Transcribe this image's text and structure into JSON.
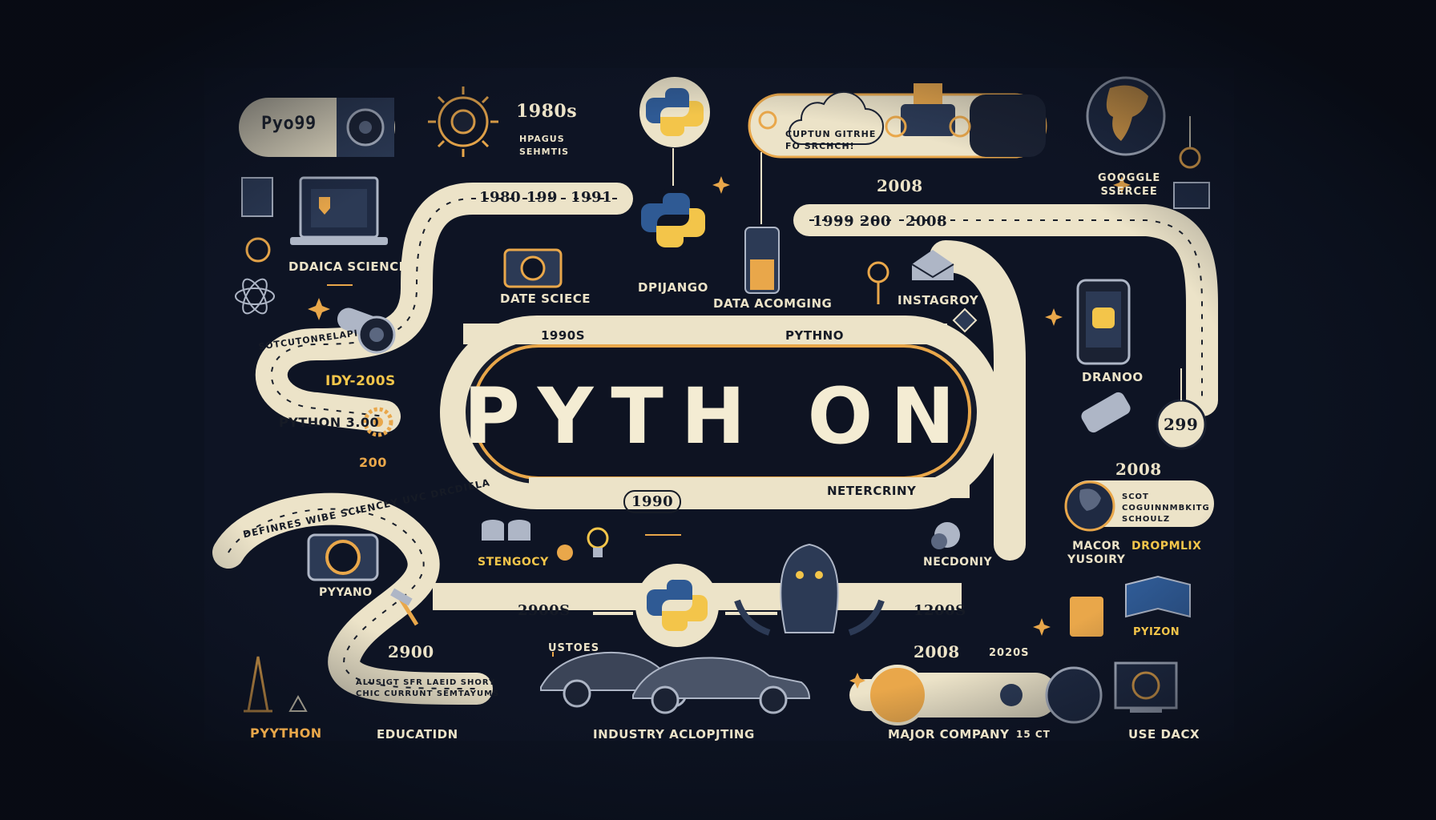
{
  "colors": {
    "background": "#0c1220",
    "road": "#ece3c8",
    "accent_gold": "#e9a74a",
    "python_blue": "#2f5a94",
    "python_yellow": "#f3c54a"
  },
  "title": "PYTH ON",
  "top_left": {
    "badge": "Pyo99",
    "year": "1980s",
    "caption": "HPAGUS\nSEHMTIS"
  },
  "left": {
    "data_science_1": "DDAICA SCIENCE",
    "data_science_2": "DATE SCIECE",
    "road_years": [
      "1980 199",
      "1991"
    ],
    "road_side_text": "SOTCUTONRELAPI",
    "year_range": "IDY-200S",
    "version": "PYTHON 3.00",
    "year_200": "200"
  },
  "center": {
    "django": "DPIJANGO",
    "data_acoming": "DATA ACOMGING",
    "cloud_caption": "CUPTUN GITRHE\nFO SRCHCH!",
    "track_top": [
      "1990S",
      "PYTHNO"
    ],
    "track_bottom": [
      "1990",
      "NETERCRINY"
    ],
    "stengocy": "STENGOCY",
    "year_2900s": "2900S",
    "ustoes": "USTOES",
    "industry": "INDUSTRY ACLOPJTING"
  },
  "right": {
    "year_2008_top": "2008",
    "road_years": [
      "1999 200",
      "2008"
    ],
    "instagroy": "INSTAGROY",
    "google": "GOOGGLE\nSSERCEE",
    "dranoo": "DRANOO",
    "circle_299": "299",
    "year_2008_mid": "2008",
    "scot_caption": "SCOT\nCOGUINNMBKITG\nSCHOULZ",
    "macor": "MACOR\nYUSOIRY",
    "dropmlix": "DROPMLIX",
    "necdoniy": "NECDONIY",
    "year_1200s": "1200S",
    "pyizon": "PYIZON",
    "year_2008_low": "2008",
    "year_2020s": "2020S",
    "major_company": "MAJOR COMPANY",
    "code_glyphs": "15 CT",
    "use_dacx": "USE DACX"
  },
  "bottom_left": {
    "arc_text": "DEFINRES WIBE SCIENCEY UVC DRCDIELA",
    "pyyano": "PYYANO",
    "year_2900": "2900",
    "caption": "ALUSIGT SFR LAEID SHORY\nCHIC CURRUNT SEMTAYUMS",
    "python": "PYYTHON",
    "education": "EDUCATIDN"
  }
}
